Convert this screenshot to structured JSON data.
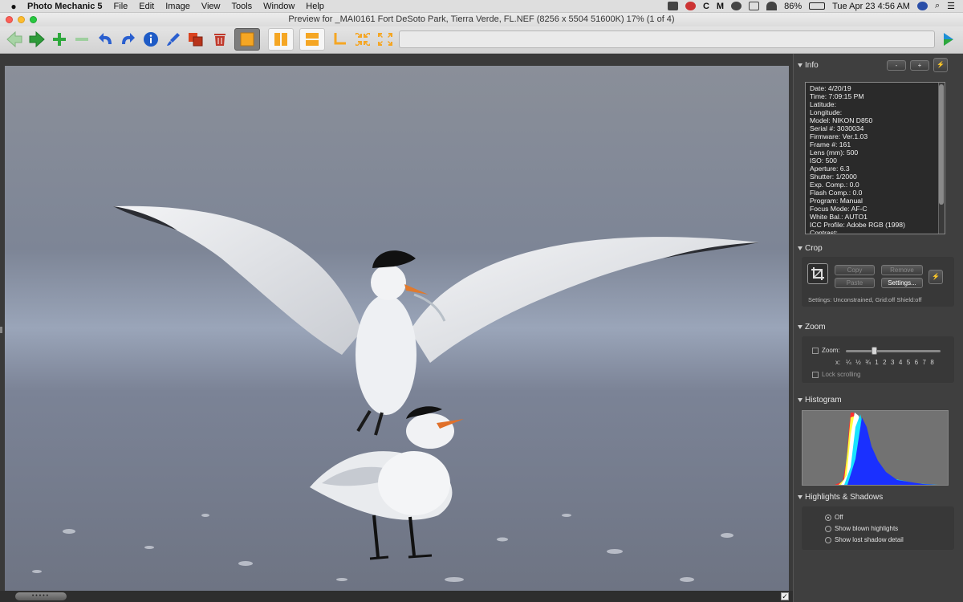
{
  "menubar": {
    "app_name": "Photo Mechanic 5",
    "menus": [
      "File",
      "Edit",
      "Image",
      "View",
      "Tools",
      "Window",
      "Help"
    ],
    "battery": "86%",
    "clock": "Tue Apr 23  4:56 AM"
  },
  "window": {
    "title": "Preview for _MAI0161 Fort DeSoto Park,  Tierra Verde, FL.NEF (8256 x 5504 51600K) 17% (1 of 4)"
  },
  "colors": {
    "back_green": "#9ccf9a",
    "forward_green": "#2e9b3a",
    "plus_green": "#2ea83c",
    "rotate_blue": "#2a5fcf",
    "info_blue": "#1e5bc6",
    "tag_orange": "#f5a623",
    "trash_red": "#c0392b"
  },
  "info": {
    "title": "Info",
    "buttons": [
      "-",
      "+",
      "⚡"
    ],
    "lines": [
      "Date: 4/20/19",
      "Time: 7:09:15 PM",
      "Latitude:",
      "Longitude:",
      "Model: NIKON D850",
      "Serial #: 3030034",
      "Firmware: Ver.1.03",
      "Frame #: 161",
      "Lens (mm): 500",
      "ISO: 500",
      "Aperture: 6.3",
      "Shutter: 1/2000",
      "Exp. Comp.: 0.0",
      "Flash Comp.: 0.0",
      "Program: Manual",
      "Focus Mode: AF-C",
      "White Bal.: AUTO1",
      "ICC Profile: Adobe RGB (1998)",
      "Contrast:"
    ]
  },
  "crop": {
    "title": "Crop",
    "copy": "Copy",
    "remove": "Remove",
    "paste": "Paste",
    "settings_button": "Settings...",
    "settings_text": "Settings:   Unconstrained, Grid:off Shield:off"
  },
  "zoom": {
    "title": "Zoom",
    "label": "Zoom:",
    "scale_prefix": "x:",
    "scale": "¼ ½ ¾ 1 2 3 4 5 6 7 8",
    "lock": "Lock scrolling",
    "slider_level": 0.3
  },
  "histogram": {
    "title": "Histogram"
  },
  "highlights": {
    "title": "Highlights & Shadows",
    "options": [
      "Off",
      "Show blown highlights",
      "Show lost shadow detail"
    ],
    "selected": 0
  },
  "bottom": {
    "checkbox": "✓"
  }
}
